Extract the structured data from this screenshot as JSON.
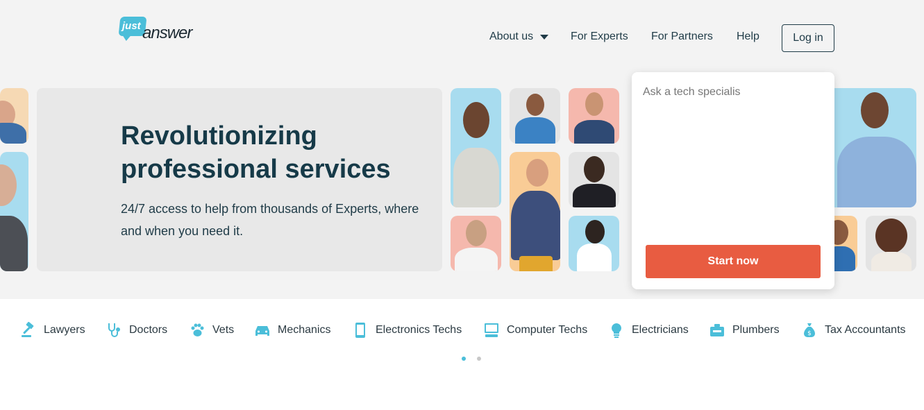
{
  "header": {
    "logo_just": "just",
    "logo_answer": "answer",
    "nav": {
      "about": "About us",
      "experts": "For Experts",
      "partners": "For Partners",
      "help": "Help"
    },
    "login": "Log in"
  },
  "hero": {
    "headline": "Revolutionizing professional services",
    "subline": "24/7 access to help from thousands of Experts, where and when you need it."
  },
  "ask": {
    "placeholder": "Ask a tech specialis",
    "button": "Start now"
  },
  "categories": [
    {
      "label": "Lawyers",
      "icon": "gavel-icon"
    },
    {
      "label": "Doctors",
      "icon": "stethoscope-icon"
    },
    {
      "label": "Vets",
      "icon": "paw-icon"
    },
    {
      "label": "Mechanics",
      "icon": "car-icon"
    },
    {
      "label": "Electronics Techs",
      "icon": "phone-icon"
    },
    {
      "label": "Computer Techs",
      "icon": "computer-icon"
    },
    {
      "label": "Electricians",
      "icon": "lightbulb-icon"
    },
    {
      "label": "Plumbers",
      "icon": "toolbox-icon"
    },
    {
      "label": "Tax Accountants",
      "icon": "money-bag-icon"
    }
  ],
  "carousel": {
    "pages": 2,
    "active": 1
  },
  "colors": {
    "accent": "#4bbed9",
    "cta": "#e85c41",
    "text": "#163a48"
  }
}
